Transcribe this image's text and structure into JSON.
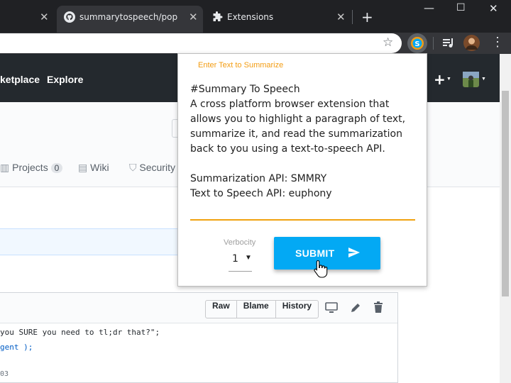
{
  "browser": {
    "tabs": [
      {
        "title": "summarytospeech/popup.js",
        "icon": "github-icon",
        "active": true
      },
      {
        "title": "Extensions",
        "icon": "puzzle-icon",
        "active": false
      }
    ],
    "new_tab_label": "+",
    "window_controls": {
      "minimize": "—",
      "maximize": "☐",
      "close": "✕"
    }
  },
  "github": {
    "nav": [
      "ketplace",
      "Explore"
    ],
    "tabs": [
      {
        "label": "Projects",
        "count": "0"
      },
      {
        "label": "Wiki"
      },
      {
        "label": "Security"
      }
    ],
    "file_buttons": [
      "Raw",
      "Blame",
      "History"
    ],
    "code_lines": [
      "you SURE you need to tl;dr that?\";",
      "gent );",
      "",
      "03"
    ]
  },
  "popup": {
    "label": "Enter Text to Summarize",
    "text": "#Summary To Speech\nA cross platform browser extension that allows you to highlight a paragraph of text, summarize it, and read the summarization back to you using a text-to-speech API.\n\nSummarization API: SMMRY\nText to Speech API: euphony",
    "verbocity_label": "Verbocity",
    "verbocity_value": "1",
    "submit_label": "SUBMIT"
  },
  "colors": {
    "accent_orange": "#f39c12",
    "submit_blue": "#03a9f4",
    "github_header": "#24292e",
    "chrome_dark": "#202124"
  }
}
